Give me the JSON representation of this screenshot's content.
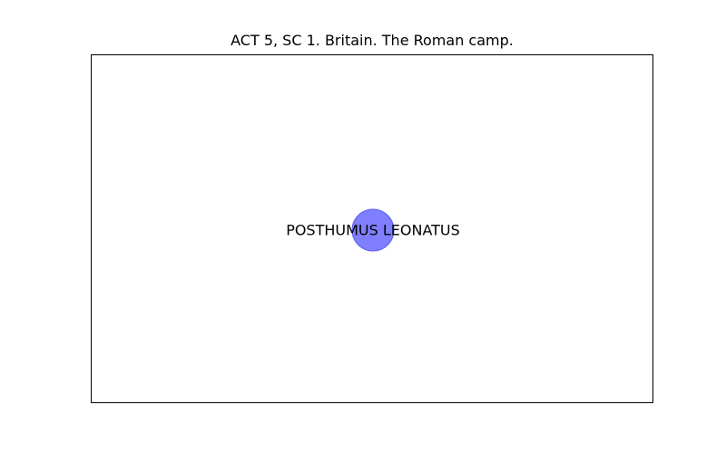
{
  "figure": {
    "title": "ACT 5, SC 1. Britain. The Roman camp."
  },
  "network": {
    "nodes": [
      {
        "label": "POSTHUMUS LEONATUS",
        "color": "#7f7fff",
        "edge_color": "#5c5cf0"
      }
    ],
    "edges": []
  }
}
